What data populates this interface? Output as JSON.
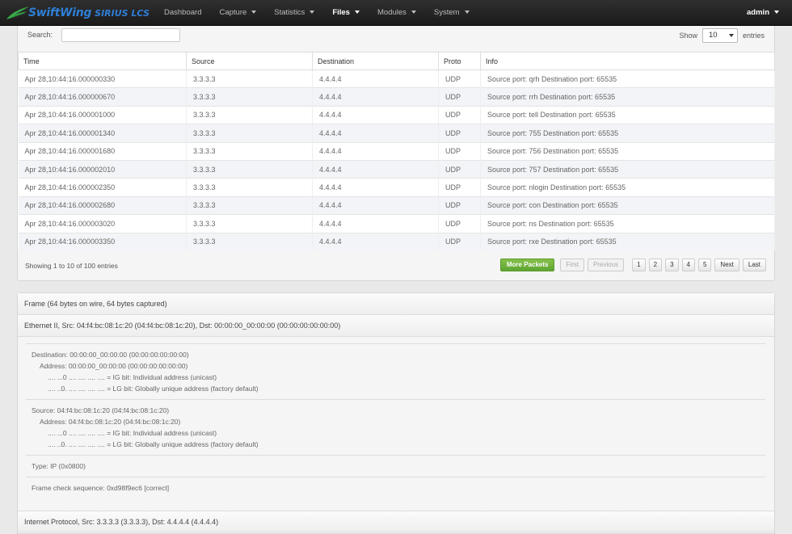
{
  "navbar": {
    "brand": "SwiftWing",
    "brand_sub": "SIRIUS LCS",
    "items": [
      {
        "label": "Dashboard",
        "has_caret": false,
        "active": false
      },
      {
        "label": "Capture",
        "has_caret": true,
        "active": false
      },
      {
        "label": "Statistics",
        "has_caret": true,
        "active": false
      },
      {
        "label": "Files",
        "has_caret": true,
        "active": true
      },
      {
        "label": "Modules",
        "has_caret": true,
        "active": false
      },
      {
        "label": "System",
        "has_caret": true,
        "active": false
      }
    ],
    "user": "admin"
  },
  "table_controls": {
    "search_label": "Search:",
    "search_value": "",
    "show_label": "Show",
    "page_size": "10",
    "entries_label": "entries"
  },
  "table": {
    "columns": [
      "Time",
      "Source",
      "Destination",
      "Proto",
      "Info"
    ],
    "rows": [
      [
        "Apr 28,10:44:16.000000330",
        "3.3.3.3",
        "4.4.4.4",
        "UDP",
        "Source port: qrh Destination port: 65535"
      ],
      [
        "Apr 28,10:44:16.000000670",
        "3.3.3.3",
        "4.4.4.4",
        "UDP",
        "Source port: rrh Destination port: 65535"
      ],
      [
        "Apr 28,10:44:16.000001000",
        "3.3.3.3",
        "4.4.4.4",
        "UDP",
        "Source port: tell Destination port: 65535"
      ],
      [
        "Apr 28,10:44:16.000001340",
        "3.3.3.3",
        "4.4.4.4",
        "UDP",
        "Source port: 755 Destination port: 65535"
      ],
      [
        "Apr 28,10:44:16.000001680",
        "3.3.3.3",
        "4.4.4.4",
        "UDP",
        "Source port: 756 Destination port: 65535"
      ],
      [
        "Apr 28,10:44:16.000002010",
        "3.3.3.3",
        "4.4.4.4",
        "UDP",
        "Source port: 757 Destination port: 65535"
      ],
      [
        "Apr 28,10:44:16.000002350",
        "3.3.3.3",
        "4.4.4.4",
        "UDP",
        "Source port: nlogin Destination port: 65535"
      ],
      [
        "Apr 28,10:44:16.000002680",
        "3.3.3.3",
        "4.4.4.4",
        "UDP",
        "Source port: con Destination port: 65535"
      ],
      [
        "Apr 28,10:44:16.000003020",
        "3.3.3.3",
        "4.4.4.4",
        "UDP",
        "Source port: ns Destination port: 65535"
      ],
      [
        "Apr 28,10:44:16.000003350",
        "3.3.3.3",
        "4.4.4.4",
        "UDP",
        "Source port: rxe Destination port: 65535"
      ]
    ],
    "info_text": "Showing 1 to 10 of 100 entries"
  },
  "pagination": {
    "more_packets": "More Packets",
    "first": "First",
    "previous": "Previous",
    "pages": [
      "1",
      "2",
      "3",
      "4",
      "5"
    ],
    "next": "Next",
    "last": "Last"
  },
  "details": {
    "frame_header": "Frame (64 bytes on wire, 64 bytes captured)",
    "ethernet_header": "Ethernet II, Src: 04:f4:bc:08:1c:20 (04:f4:bc:08:1c:20), Dst: 00:00:00_00:00:00 (00:00:00:00:00:00)",
    "groups": [
      [
        {
          "indent": 0,
          "text": "Destination: 00:00:00_00:00:00 (00:00:00:00:00:00)"
        },
        {
          "indent": 1,
          "text": "Address: 00:00:00_00:00:00 (00:00:00:00:00:00)"
        },
        {
          "indent": 2,
          "text": ".... ...0 .... .... .... .... = IG bit: Individual address (unicast)"
        },
        {
          "indent": 2,
          "text": ".... ..0. .... .... .... .... = LG bit: Globally unique address (factory default)"
        }
      ],
      [
        {
          "indent": 0,
          "text": "Source: 04:f4:bc:08:1c:20 (04:f4:bc:08:1c:20)"
        },
        {
          "indent": 1,
          "text": "Address: 04:f4:bc:08:1c:20 (04:f4:bc:08:1c:20)"
        },
        {
          "indent": 2,
          "text": ".... ...0 .... .... .... .... = IG bit: Individual address (unicast)"
        },
        {
          "indent": 2,
          "text": ".... ..0. .... .... .... .... = LG bit: Globally unique address (factory default)"
        }
      ],
      [
        {
          "indent": 0,
          "text": "Type: IP (0x0800)"
        }
      ],
      [
        {
          "indent": 0,
          "text": "Frame check sequence: 0xd98f9ec6 [correct]"
        }
      ]
    ],
    "ip_header": "Internet Protocol, Src: 3.3.3.3 (3.3.3.3), Dst: 4.4.4.4 (4.4.4.4)"
  },
  "colors": {
    "brand": "#2e7fd6",
    "logo_green": "#3aa84a",
    "navbar": "#1b1b1b",
    "more_packets": "#6fb23c"
  }
}
